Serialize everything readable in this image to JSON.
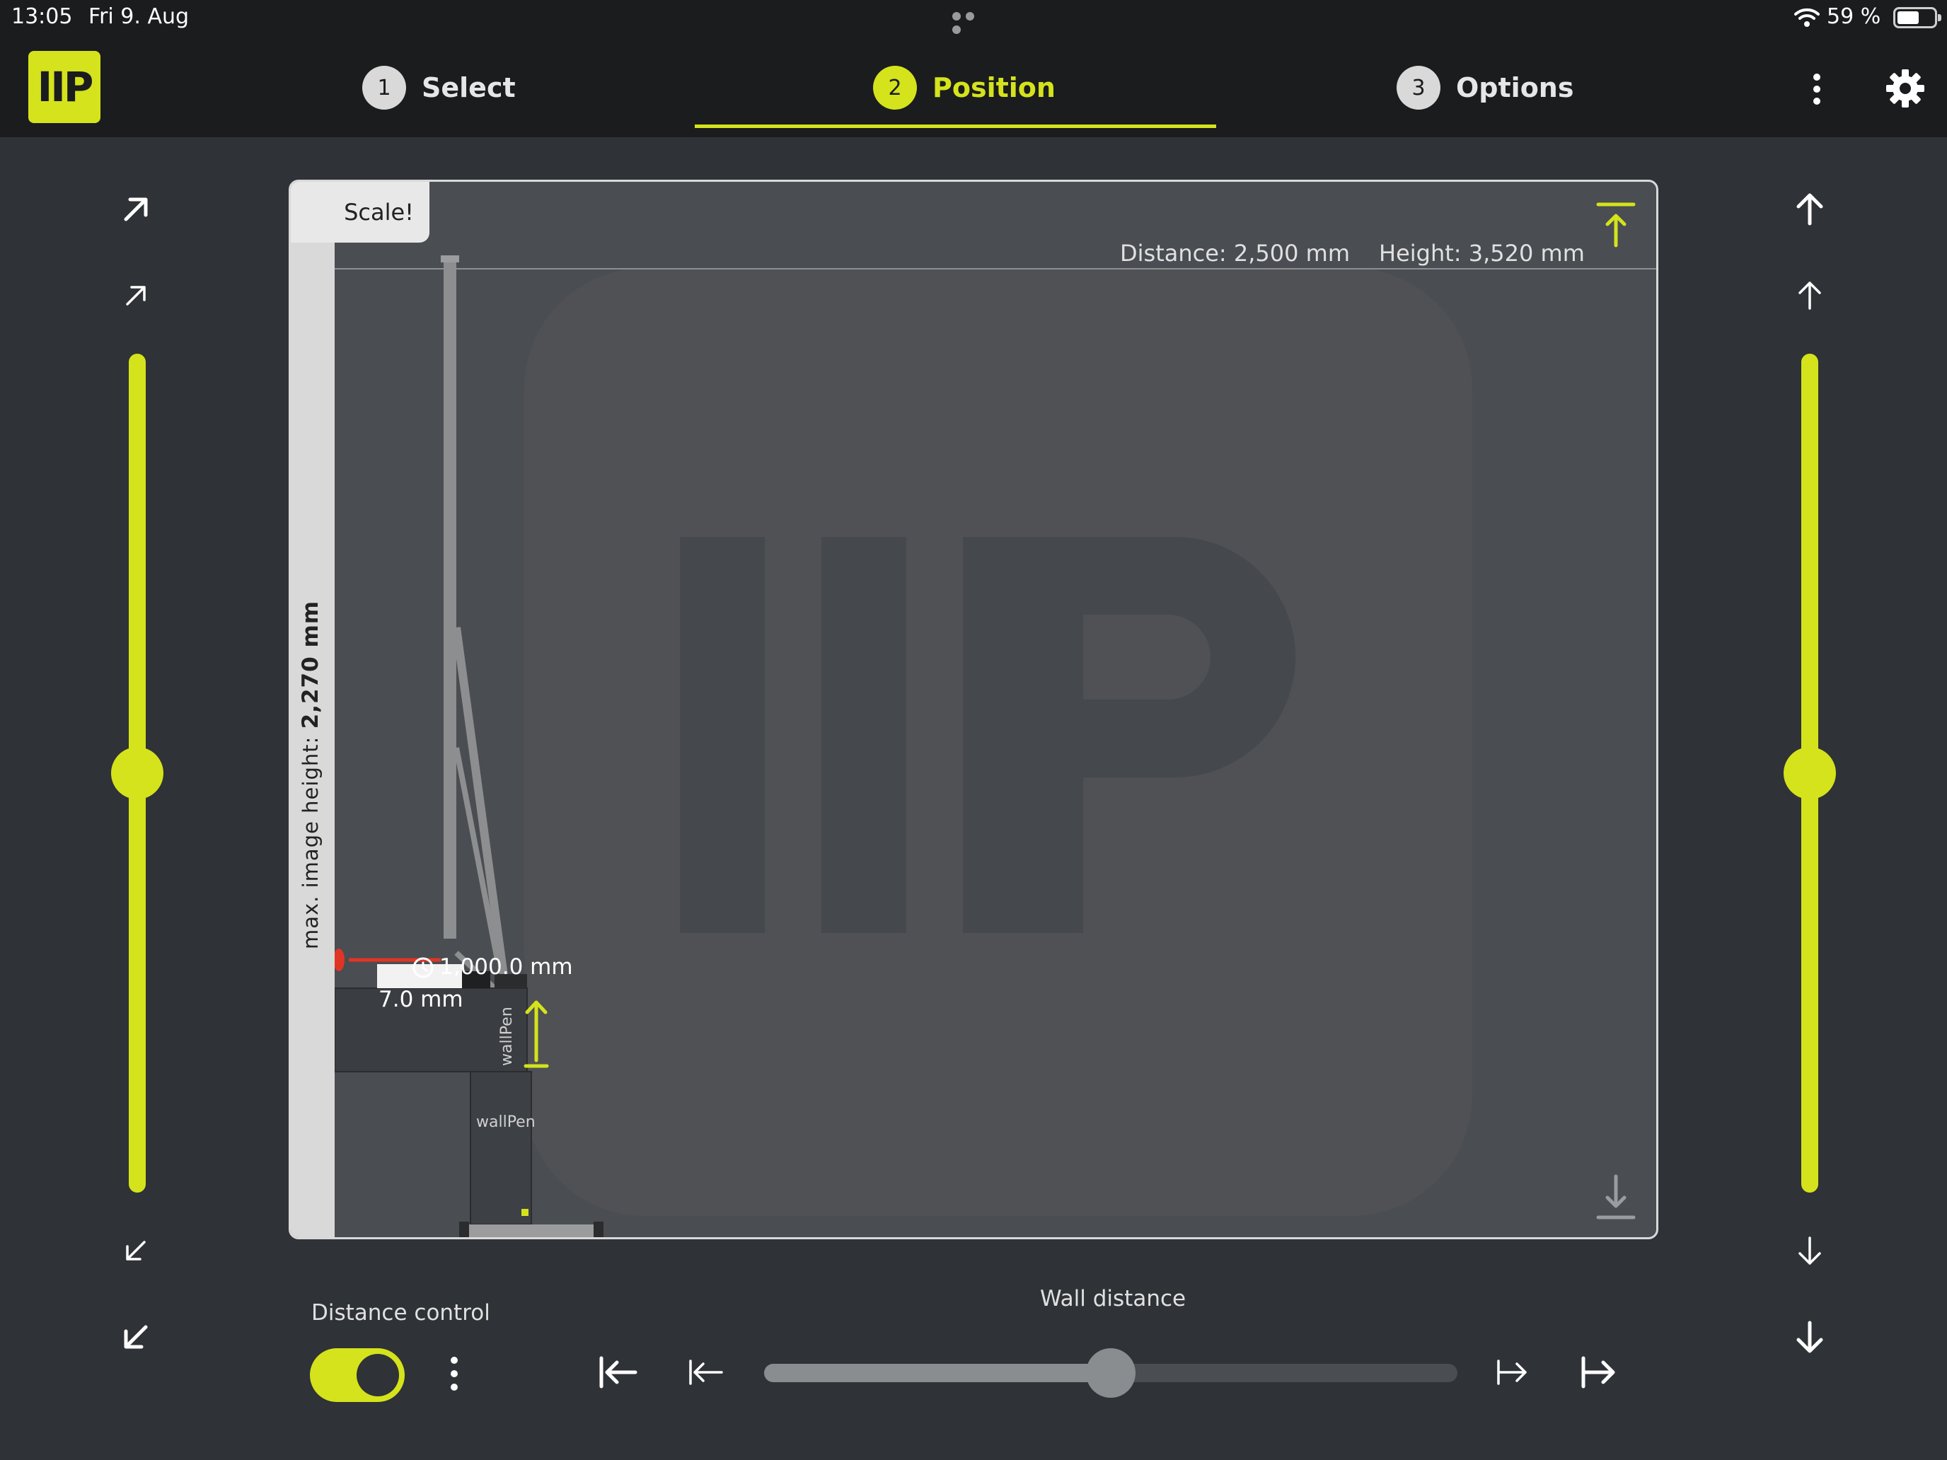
{
  "status_bar": {
    "time": "13:05",
    "date": "Fri 9. Aug",
    "battery_text": "59 %",
    "battery_level": 0.59
  },
  "header": {
    "logo_text": "IIP",
    "steps": [
      {
        "number": "1",
        "label": "Select"
      },
      {
        "number": "2",
        "label": "Position"
      },
      {
        "number": "3",
        "label": "Options"
      }
    ],
    "active_step": 2
  },
  "canvas": {
    "scale_button": "Scale!",
    "max_height_label": "max. image height: ",
    "max_height_value": "2,270 mm",
    "distance_text": "Distance: 2,500 mm",
    "height_text": "Height: 3,520 mm",
    "carriage_offset": "1,000.0 mm",
    "carriage_step": "7.0 mm",
    "machine_brand": "wallPen"
  },
  "left_slider": {
    "value_fraction": 0.5
  },
  "right_slider": {
    "value_fraction": 0.5
  },
  "bottom": {
    "distance_control_label": "Distance control",
    "distance_control_on": true,
    "wall_distance_label": "Wall distance",
    "wall_distance_fraction": 0.5
  },
  "colors": {
    "accent": "#d4e31c",
    "background": "#2f3236",
    "header": "#1b1c1e",
    "canvas": "#4a4d51"
  }
}
